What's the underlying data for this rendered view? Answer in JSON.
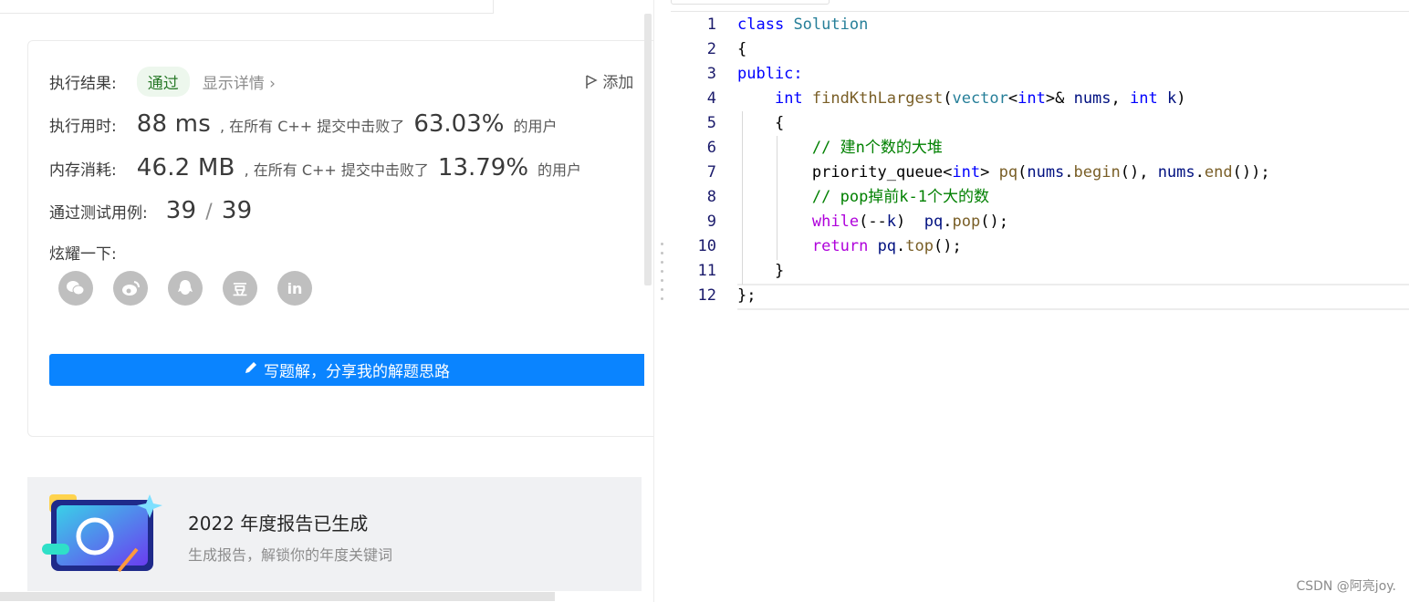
{
  "result": {
    "status_label": "执行结果:",
    "status_value": "通过",
    "detail_link": "显示详情",
    "detail_chevron": "›",
    "add_note": "添加"
  },
  "runtime": {
    "label": "执行用时:",
    "value": "88 ms",
    "beat_text": ", 在所有 C++ 提交中击败了",
    "percent": "63.03%",
    "users_suffix": "的用户"
  },
  "memory": {
    "label": "内存消耗:",
    "value": "46.2 MB",
    "beat_text": ", 在所有 C++ 提交中击败了",
    "percent": "13.79%",
    "users_suffix": "的用户"
  },
  "tests": {
    "label": "通过测试用例:",
    "passed": "39",
    "separator": "/",
    "total": "39"
  },
  "share": {
    "label": "炫耀一下:",
    "icons": [
      "wechat-icon",
      "weibo-icon",
      "qq-icon",
      "douban-icon",
      "linkedin-icon"
    ],
    "douban_glyph": "豆",
    "linkedin_glyph": "in"
  },
  "write_solution_button": "写题解，分享我的解题思路",
  "report_card": {
    "title": "2022 年度报告已生成",
    "subtitle": "生成报告，解锁你的年度关键词"
  },
  "editor": {
    "line_numbers": [
      "1",
      "2",
      "3",
      "4",
      "5",
      "6",
      "7",
      "8",
      "9",
      "10",
      "11",
      "12"
    ]
  },
  "watermark": "CSDN @阿亮joy.",
  "colors": {
    "accent_blue": "#0a84ff",
    "pass_green": "#2a7a2a",
    "keyword": "#0000ff",
    "type": "#267f99",
    "function": "#795e26",
    "control": "#af00db",
    "comment": "#008000"
  }
}
